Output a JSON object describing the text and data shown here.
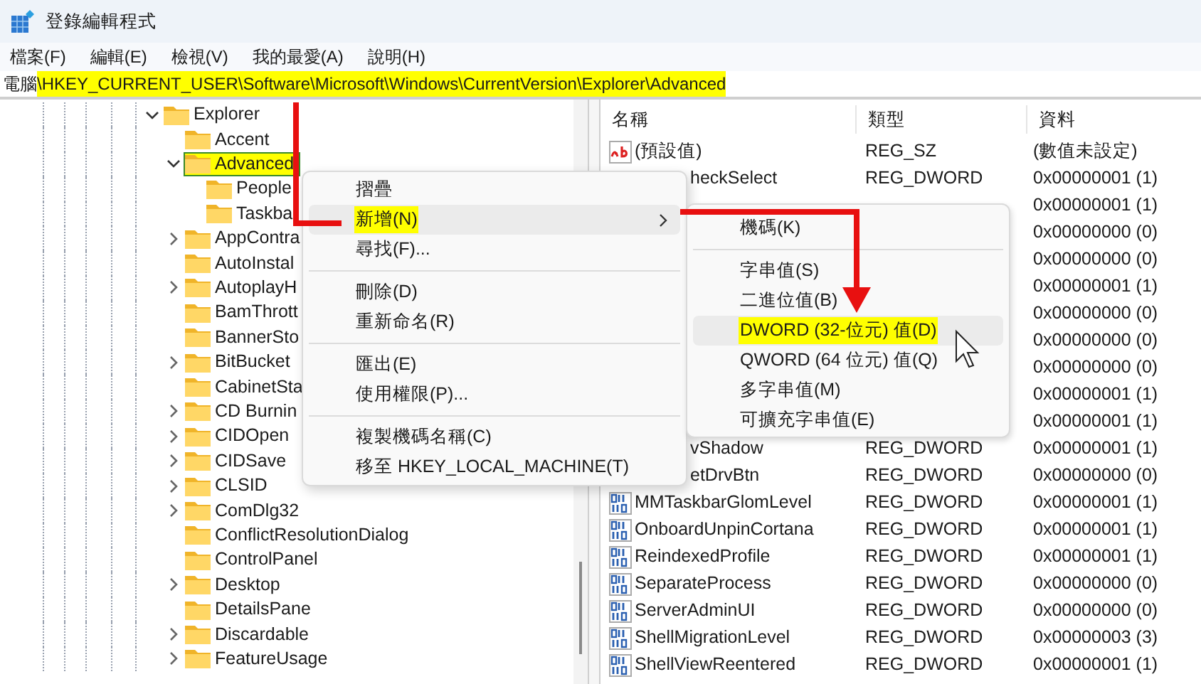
{
  "window": {
    "title": "登錄編輯程式"
  },
  "menu_bar": [
    {
      "label": "檔案(F)"
    },
    {
      "label": "編輯(E)"
    },
    {
      "label": "檢視(V)"
    },
    {
      "label": "我的最愛(A)"
    },
    {
      "label": "說明(H)"
    }
  ],
  "address": {
    "prefix": "電腦",
    "path": "\\HKEY_CURRENT_USER\\Software\\Microsoft\\Windows\\CurrentVersion\\Explorer\\Advanced",
    "highlighted": true
  },
  "tree": [
    {
      "label": "Explorer",
      "expandable": true,
      "expanded": true,
      "selected": false,
      "children": [
        {
          "label": "Accent",
          "expandable": false,
          "selected": false
        },
        {
          "label": "Advanced",
          "expandable": true,
          "expanded": true,
          "selected": true,
          "children": [
            {
              "label": "People",
              "expandable": false,
              "selected": false
            },
            {
              "label": "Taskba",
              "expandable": false,
              "selected": false
            }
          ]
        },
        {
          "label": "AppContra",
          "expandable": true,
          "expanded": false,
          "selected": false
        },
        {
          "label": "AutoInstal",
          "expandable": false,
          "selected": false
        },
        {
          "label": "AutoplayH",
          "expandable": true,
          "expanded": false,
          "selected": false
        },
        {
          "label": "BamThrott",
          "expandable": false,
          "selected": false
        },
        {
          "label": "BannerSto",
          "expandable": false,
          "selected": false
        },
        {
          "label": "BitBucket",
          "expandable": true,
          "expanded": false,
          "selected": false
        },
        {
          "label": "CabinetSta",
          "expandable": false,
          "selected": false
        },
        {
          "label": "CD Burnin",
          "expandable": true,
          "expanded": false,
          "selected": false
        },
        {
          "label": "CIDOpen",
          "expandable": true,
          "expanded": false,
          "selected": false
        },
        {
          "label": "CIDSave",
          "expandable": true,
          "expanded": false,
          "selected": false
        },
        {
          "label": "CLSID",
          "expandable": true,
          "expanded": false,
          "selected": false
        },
        {
          "label": "ComDlg32",
          "expandable": true,
          "expanded": false,
          "selected": false
        },
        {
          "label": "ConflictResolutionDialog",
          "expandable": false,
          "selected": false
        },
        {
          "label": "ControlPanel",
          "expandable": false,
          "selected": false
        },
        {
          "label": "Desktop",
          "expandable": true,
          "expanded": false,
          "selected": false
        },
        {
          "label": "DetailsPane",
          "expandable": false,
          "selected": false
        },
        {
          "label": "Discardable",
          "expandable": true,
          "expanded": false,
          "selected": false
        },
        {
          "label": "FeatureUsage",
          "expandable": true,
          "expanded": false,
          "selected": false
        }
      ]
    }
  ],
  "table": {
    "columns": [
      "名稱",
      "類型",
      "資料"
    ],
    "rows": [
      {
        "kind": "sz",
        "name": "(預設值)",
        "type": "REG_SZ",
        "data": "(數值未設定)"
      },
      {
        "kind": "partial",
        "name": "heckSelect",
        "type": "REG_DWORD",
        "data": "0x00000001 (1)"
      },
      {
        "kind": "hidden",
        "data": "0x00000001 (1)"
      },
      {
        "kind": "hidden",
        "data": "0x00000000 (0)"
      },
      {
        "kind": "hidden",
        "data": "0x00000000 (0)"
      },
      {
        "kind": "hidden",
        "data": "0x00000001 (1)"
      },
      {
        "kind": "hidden",
        "data": "0x00000000 (0)"
      },
      {
        "kind": "hidden",
        "data": "0x00000000 (0)"
      },
      {
        "kind": "hidden",
        "data": "0x00000000 (0)"
      },
      {
        "kind": "hidden",
        "data": "0x00000001 (1)"
      },
      {
        "kind": "hidden",
        "data": "0x00000001 (1)"
      },
      {
        "kind": "partial",
        "name": "vShadow",
        "type": "REG_DWORD",
        "data": "0x00000001 (1)"
      },
      {
        "kind": "partial",
        "name": "etDrvBtn",
        "type": "REG_DWORD",
        "data": "0x00000000 (0)"
      },
      {
        "kind": "dword",
        "name": "MMTaskbarGlomLevel",
        "type": "REG_DWORD",
        "data": "0x00000001 (1)"
      },
      {
        "kind": "dword",
        "name": "OnboardUnpinCortana",
        "type": "REG_DWORD",
        "data": "0x00000001 (1)"
      },
      {
        "kind": "dword",
        "name": "ReindexedProfile",
        "type": "REG_DWORD",
        "data": "0x00000001 (1)"
      },
      {
        "kind": "dword",
        "name": "SeparateProcess",
        "type": "REG_DWORD",
        "data": "0x00000000 (0)"
      },
      {
        "kind": "dword",
        "name": "ServerAdminUI",
        "type": "REG_DWORD",
        "data": "0x00000000 (0)"
      },
      {
        "kind": "dword",
        "name": "ShellMigrationLevel",
        "type": "REG_DWORD",
        "data": "0x00000003 (3)"
      },
      {
        "kind": "dword",
        "name": "ShellViewReentered",
        "type": "REG_DWORD",
        "data": "0x00000001 (1)"
      }
    ]
  },
  "context_menu": [
    {
      "kind": "item",
      "label": "摺疊",
      "selected": false
    },
    {
      "kind": "submenu",
      "label": "新增(N)",
      "selected": true
    },
    {
      "kind": "item",
      "label": "尋找(F)...",
      "selected": false
    },
    {
      "kind": "separator"
    },
    {
      "kind": "item",
      "label": "刪除(D)",
      "selected": false
    },
    {
      "kind": "item",
      "label": "重新命名(R)",
      "selected": false
    },
    {
      "kind": "separator"
    },
    {
      "kind": "item",
      "label": "匯出(E)",
      "selected": false
    },
    {
      "kind": "item",
      "label": "使用權限(P)...",
      "selected": false
    },
    {
      "kind": "separator"
    },
    {
      "kind": "item",
      "label": "複製機碼名稱(C)",
      "selected": false
    },
    {
      "kind": "item",
      "label": "移至 HKEY_LOCAL_MACHINE(T)",
      "selected": false
    }
  ],
  "submenu": [
    {
      "kind": "item",
      "label": "機碼(K)",
      "selected": false
    },
    {
      "kind": "separator"
    },
    {
      "kind": "item",
      "label": "字串值(S)",
      "selected": false
    },
    {
      "kind": "item",
      "label": "二進位值(B)",
      "selected": false
    },
    {
      "kind": "item",
      "label": "DWORD (32-位元) 值(D)",
      "selected": true
    },
    {
      "kind": "item",
      "label": "QWORD (64 位元) 值(Q)",
      "selected": false
    },
    {
      "kind": "item",
      "label": "多字串值(M)",
      "selected": false
    },
    {
      "kind": "item",
      "label": "可擴充字串值(E)",
      "selected": false
    }
  ]
}
